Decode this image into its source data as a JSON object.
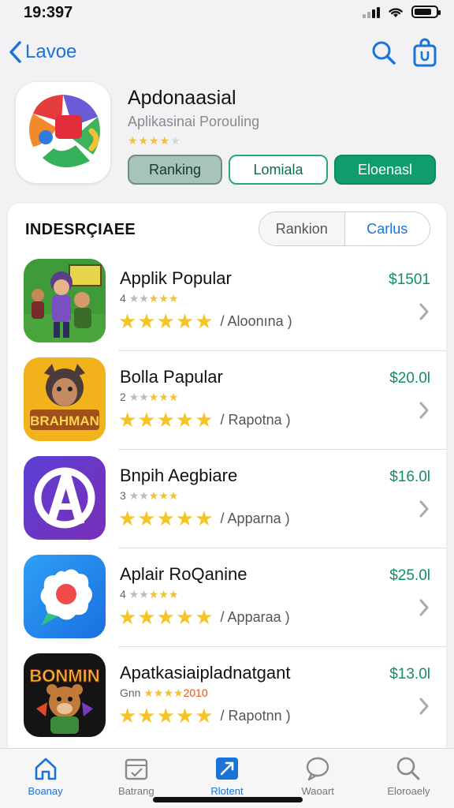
{
  "status_bar": {
    "time": "19:397"
  },
  "nav": {
    "back_label": "Lavoe"
  },
  "app": {
    "title": "Apdonaasial",
    "subtitle": "Aplikasinai Porouling",
    "stars": 4,
    "buttons": [
      "Ranking",
      "Lomiala",
      "Eloenasl"
    ]
  },
  "section": {
    "title": "INDESRÇIAEE",
    "segments": [
      "Rankion",
      "Carlus"
    ]
  },
  "apps": [
    {
      "name": "Applik Popular",
      "mini_rank": "4",
      "mini_stars": 5,
      "rating_label": "/ Aloonına )",
      "price": "$1501",
      "stars": 5
    },
    {
      "name": "Bolla Papular",
      "mini_rank": "2",
      "mini_stars": 5,
      "rating_label": "/ Rapotna )",
      "price": "$20.0l",
      "stars": 5
    },
    {
      "name": "Bnpih Aegbiare",
      "mini_rank": "3",
      "mini_stars": 5,
      "rating_label": "/ Apparna )",
      "price": "$16.0l",
      "stars": 5
    },
    {
      "name": "Aplair RoQanine",
      "mini_rank": "4",
      "mini_stars": 5,
      "rating_label": "/ Apparaa )",
      "price": "$25.0l",
      "stars": 5
    },
    {
      "name": "Apatkasiaipladnatgant",
      "mini_rank": "Gnn",
      "mini_stars": 5,
      "mini_extra": "2010",
      "rating_label": "/ Rapotnn )",
      "price": "$13.0l",
      "stars": 5
    }
  ],
  "tabs": [
    {
      "label": "Boanay",
      "icon": "home-icon",
      "active": false
    },
    {
      "label": "Batrang",
      "icon": "calendar-icon",
      "active": false
    },
    {
      "label": "Rlotent",
      "icon": "apps-icon",
      "active": true
    },
    {
      "label": "Waoart",
      "icon": "chat-icon",
      "active": false
    },
    {
      "label": "Eloroaely",
      "icon": "search-icon",
      "active": false
    }
  ],
  "colors": {
    "accent_blue": "#1a73d9",
    "accent_green": "#109c6c",
    "star_yellow": "#f5c527",
    "price_green": "#0f8f63"
  }
}
